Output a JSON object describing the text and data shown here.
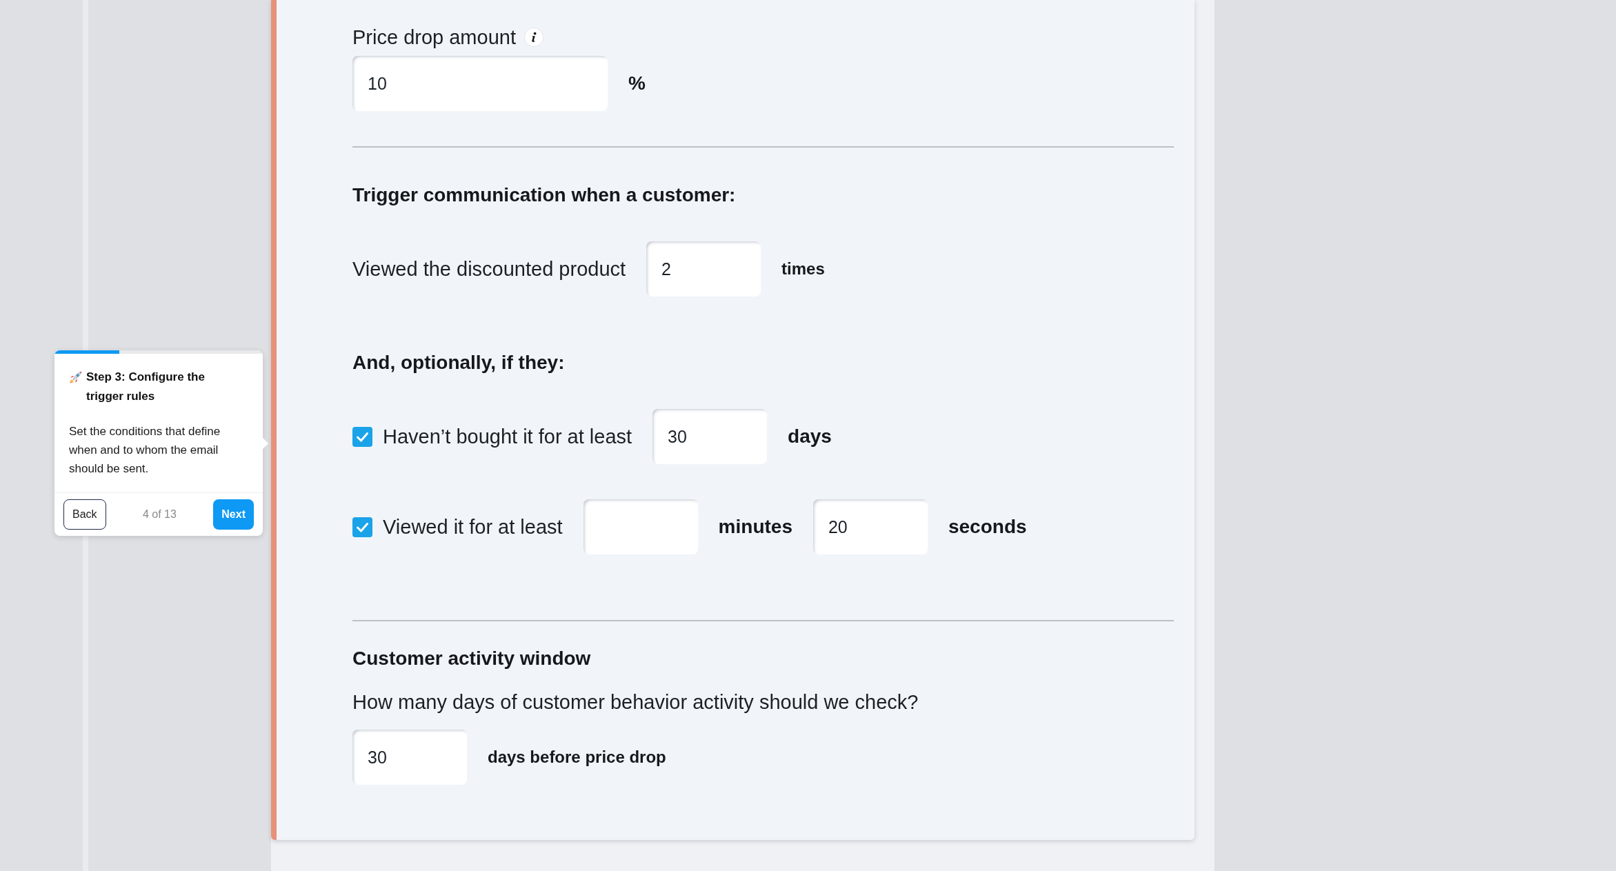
{
  "price_drop": {
    "label": "Price drop amount",
    "value": "10",
    "unit": "%"
  },
  "trigger": {
    "heading": "Trigger communication when a customer:",
    "condition": {
      "label": "Viewed the discounted product",
      "value": "2",
      "unit": "times"
    }
  },
  "optional": {
    "heading": "And, optionally, if they:",
    "conditions": [
      {
        "label": "Haven’t bought it for at least",
        "checked": true,
        "fields": [
          {
            "value": "30",
            "unit": "days"
          }
        ]
      },
      {
        "label": "Viewed it for at least",
        "checked": true,
        "fields": [
          {
            "unit": "minutes"
          },
          {
            "value": "20",
            "unit": "seconds"
          }
        ]
      }
    ]
  },
  "activity_window": {
    "heading": "Customer activity window",
    "question": "How many days of customer behavior activity should we check?",
    "value": "30",
    "unit": "days before price drop"
  },
  "tour_step": {
    "level": 0.31,
    "title": "Step 3: Configure the trigger rules",
    "body": "Set the conditions that define when and to whom the email should be sent.",
    "back_button": "Back",
    "counter": "4 of 13",
    "next_button": "Next"
  }
}
